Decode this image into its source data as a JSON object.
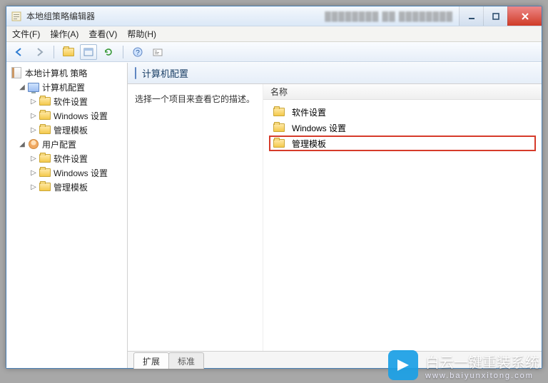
{
  "window": {
    "title": "本地组策略编辑器"
  },
  "menu": {
    "file": "文件(F)",
    "action": "操作(A)",
    "view": "查看(V)",
    "help": "帮助(H)"
  },
  "tree": {
    "root": "本地计算机 策略",
    "computer": "计算机配置",
    "user": "用户配置",
    "children": {
      "software": "软件设置",
      "windows": "Windows 设置",
      "admin": "管理模板"
    }
  },
  "content": {
    "heading": "计算机配置",
    "desc": "选择一个项目来查看它的描述。",
    "col_name": "名称",
    "rows": {
      "software": "软件设置",
      "windows": "Windows 设置",
      "admin": "管理模板"
    }
  },
  "tabs": {
    "ext": "扩展",
    "std": "标准"
  },
  "watermark": {
    "brand": "白云一键重装系统",
    "url": "www.baiyunxitong.com"
  }
}
